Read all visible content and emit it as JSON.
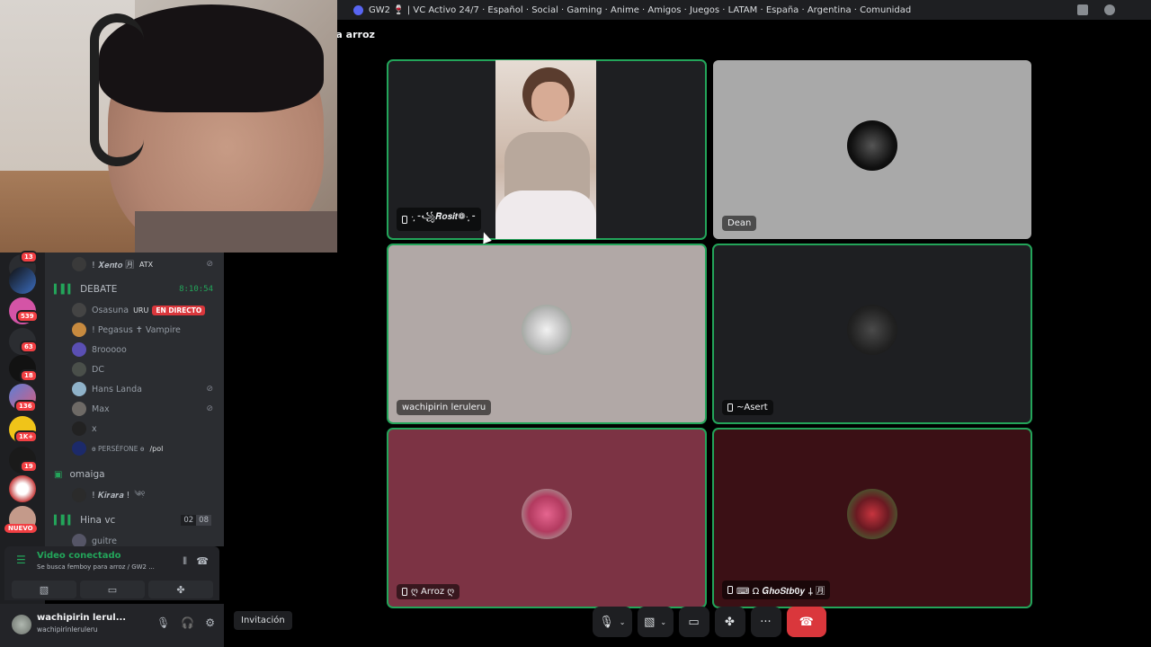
{
  "titlebar": {
    "server_title": "GW2 🍷 | VC Activo 24/7 · Español · Social · Gaming · Anime · Amigos · Juegos · LATAM · España · Argentina · Comunidad",
    "icons": [
      "inbox-icon",
      "help-icon"
    ]
  },
  "channel_header": "ra arroz",
  "rail": {
    "badges": [
      "13",
      "539",
      "63",
      "18",
      "136",
      "1K+",
      "19"
    ],
    "nuevo": "NUEVO"
  },
  "channels": {
    "top_user": {
      "name": "! 𝑿𝒆𝒏𝒕𝒐 🈷",
      "tag": "ATX"
    },
    "debate": {
      "name": "DEBATE",
      "timer": "8:10:54",
      "members": [
        {
          "name": "Osasuna",
          "tag": "URU",
          "live": "EN DIRECTO"
        },
        {
          "name": "! Pegasus ✝ Vampire"
        },
        {
          "name": "8rooooo"
        },
        {
          "name": "DC"
        },
        {
          "name": "Hans Landa"
        },
        {
          "name": "Max"
        },
        {
          "name": "x"
        },
        {
          "name": "ɵ PERSÉFONE ɵ",
          "tag": "/pol"
        }
      ]
    },
    "omaiga": {
      "name": "omaiga",
      "members": [
        {
          "name": "! 𝑲𝒊𝒓𝒂𝒓𝒂 !",
          "tag": "༄ٜ୧"
        }
      ]
    },
    "hina": {
      "name": "Hina vc",
      "count_a": "02",
      "count_b": "08"
    },
    "partial_member": "guitre"
  },
  "voice_panel": {
    "status": "Video conectado",
    "subtitle": "Se busca femboy para arroz / GW2 ..."
  },
  "user_panel": {
    "display_name": "wachipirin lerul...",
    "username": "wachipirinleruleru"
  },
  "tiles": [
    {
      "label": "·̩͙ ⁃꧁𝑹𝒐𝒔𝒊𝒕❁·̩͙ ⁃",
      "mobile": true,
      "speaking": true
    },
    {
      "label": "Dean",
      "mobile": false,
      "speaking": false
    },
    {
      "label": "wachipirin leruleru",
      "mobile": false,
      "speaking": true
    },
    {
      "label": "~Asert",
      "mobile": true,
      "speaking": true
    },
    {
      "label": "ღ Arroz ღ",
      "mobile": true,
      "speaking": true
    },
    {
      "label": "⌨ Ω 𝑮𝒉𝒐𝑺𝒕𝒃𝟎𝒚 ⸸ 🈷",
      "mobile": true,
      "speaking": true
    }
  ],
  "bottom": {
    "invite": "Invitación"
  },
  "colors": {
    "speaking": "#23a55a",
    "hangup": "#da373c",
    "badge": "#f23f43"
  }
}
